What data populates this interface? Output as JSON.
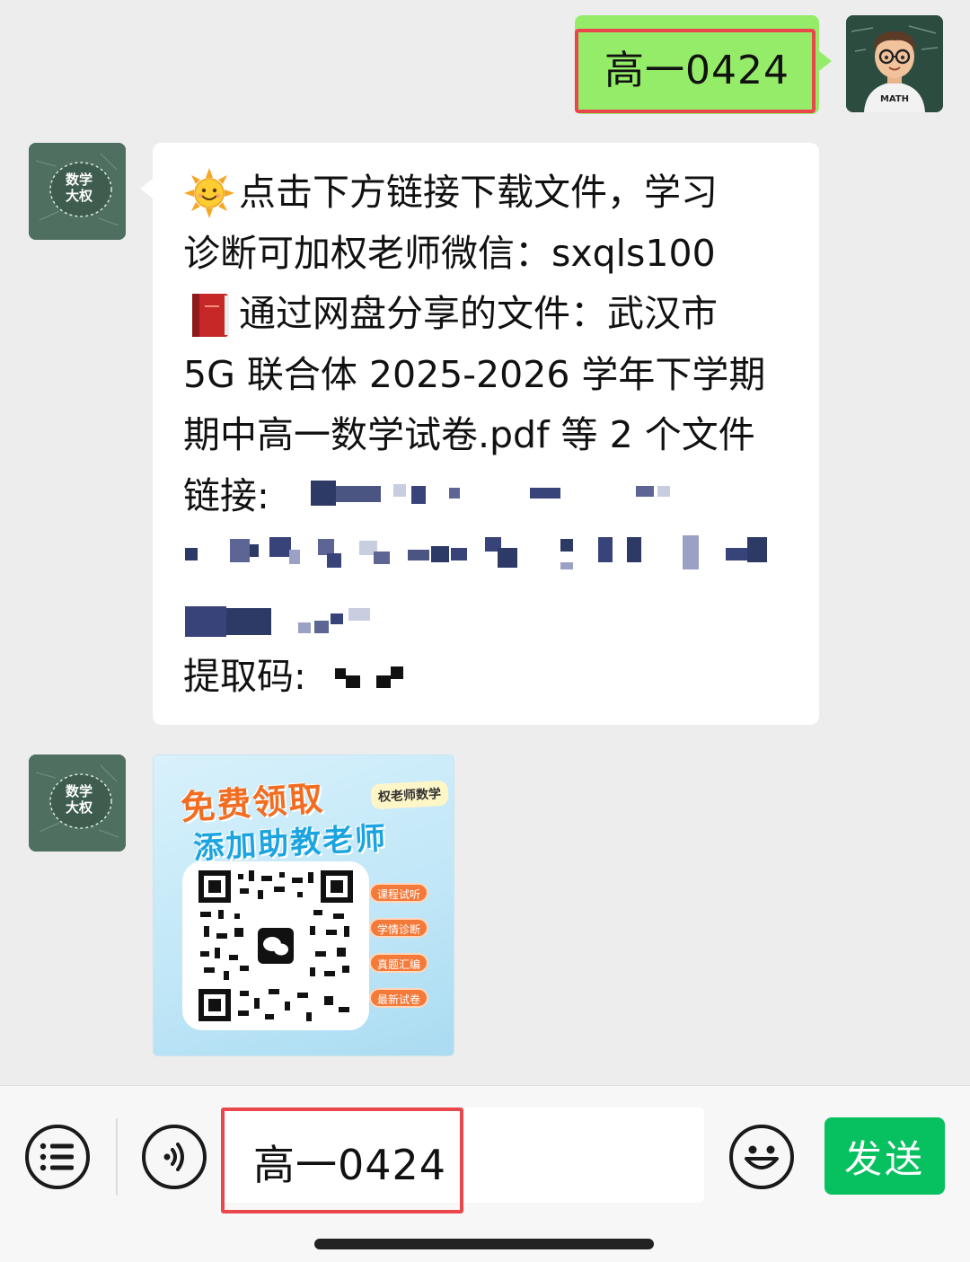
{
  "chat": {
    "outgoing": {
      "text": "高一0424",
      "avatar_label": "MATH"
    },
    "bot": {
      "avatar_line1": "数学",
      "avatar_line2": "大权"
    },
    "incoming_lines": [
      "点击下方链接下载文件，学习",
      "诊断可加权老师微信：sxqls100",
      "通过网盘分享的文件：武汉市",
      "5G 联合体 2025-2026 学年下学期",
      "期中高一数学试卷.pdf 等 2 个文件",
      "链接:",
      "提取码:"
    ],
    "incoming_icons": {
      "line1": "sun-emoji-icon",
      "line3": "red-book-emoji-icon"
    },
    "promo": {
      "title1": "免费领取",
      "title2": "添加助教老师",
      "tag": "权老师数学",
      "chips": [
        "课程试听",
        "学情诊断",
        "真题汇编",
        "最新试卷"
      ]
    }
  },
  "input_bar": {
    "field_value": "高一0424",
    "send_label": "发送",
    "icons": [
      "list-menu-icon",
      "voice-icon",
      "emoji-smile-icon"
    ]
  },
  "colors": {
    "outgoing_bubble": "#95ec69",
    "highlight": "#e9474c",
    "send": "#07c160",
    "background": "#ededed"
  }
}
